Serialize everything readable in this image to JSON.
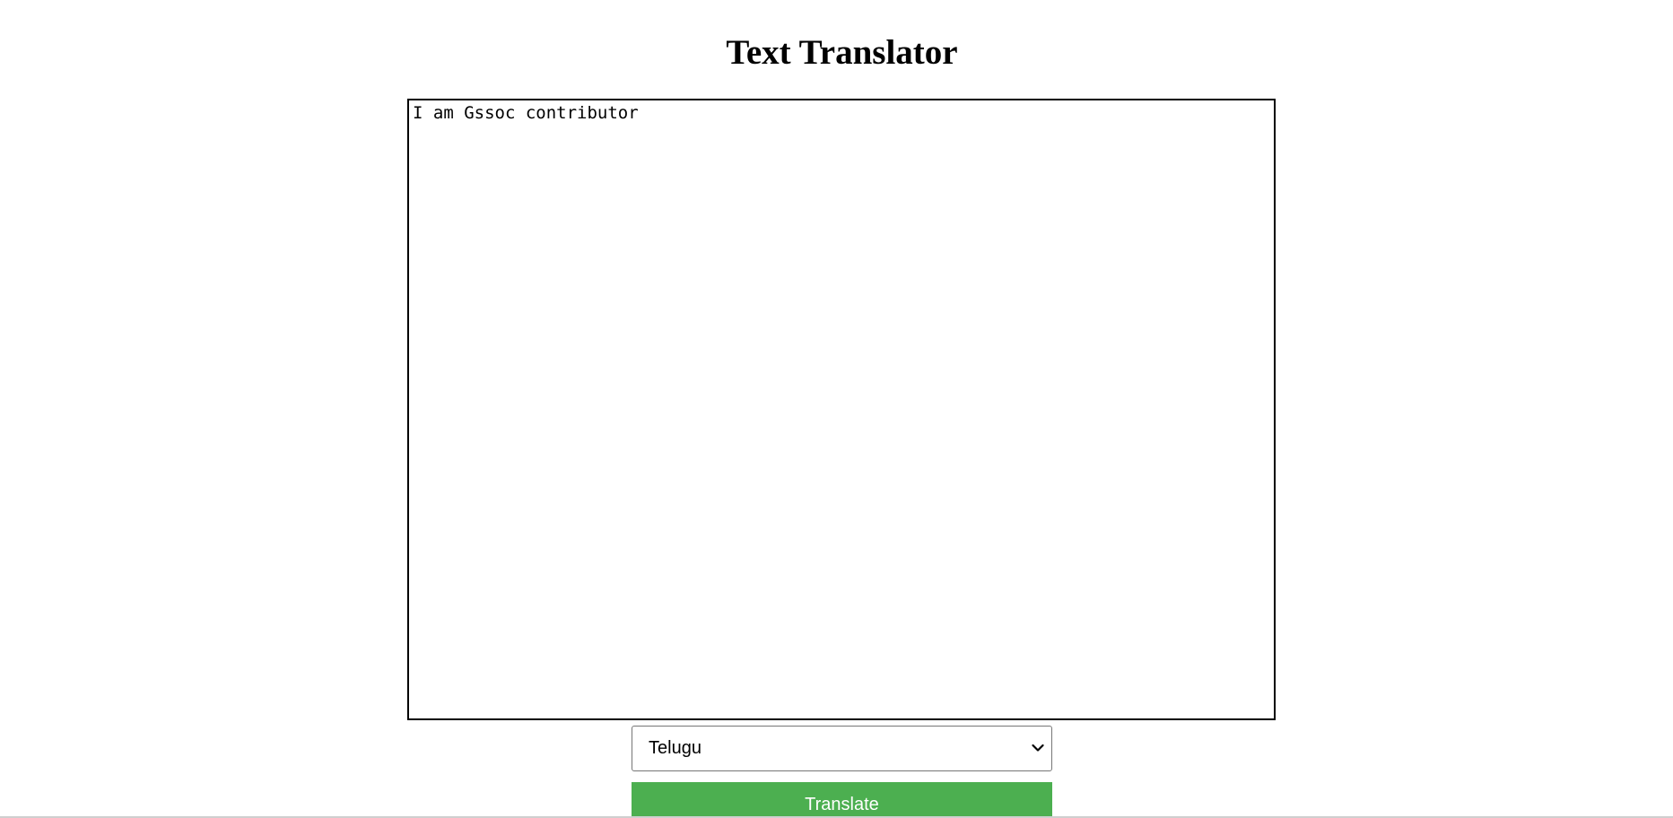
{
  "page": {
    "title": "Text Translator"
  },
  "translator": {
    "source_text": "I am Gssoc contributor",
    "language": {
      "selected": "Telugu",
      "options": [
        "Telugu"
      ]
    },
    "translate_label": "Translate"
  },
  "colors": {
    "button_background": "#4caf50",
    "button_text": "#ffffff"
  },
  "icons": {
    "select_arrow": "chevron-down-icon"
  }
}
